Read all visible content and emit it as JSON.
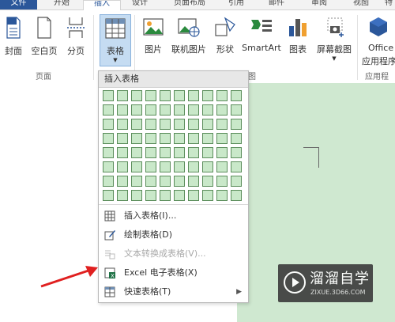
{
  "tabs": [
    {
      "label": "文件"
    },
    {
      "label": "开始"
    },
    {
      "label": "插入"
    },
    {
      "label": "设计"
    },
    {
      "label": "页面布局"
    },
    {
      "label": "引用"
    },
    {
      "label": "邮件"
    },
    {
      "label": "审阅"
    },
    {
      "label": "视图"
    },
    {
      "label": "特"
    }
  ],
  "ribbon": {
    "pages_group": {
      "label": "页面",
      "buttons": [
        {
          "label": "封面",
          "icon": "cover-page-icon"
        },
        {
          "label": "空白页",
          "icon": "blank-page-icon"
        },
        {
          "label": "分页",
          "icon": "page-break-icon"
        }
      ]
    },
    "table_button": {
      "label": "表格",
      "icon": "table-icon"
    },
    "illustrations_group": {
      "label": "图",
      "buttons": [
        {
          "label": "图片",
          "icon": "picture-icon"
        },
        {
          "label": "联机图片",
          "icon": "online-picture-icon"
        },
        {
          "label": "形状",
          "icon": "shapes-icon"
        },
        {
          "label": "SmartArt",
          "icon": "smartart-icon"
        },
        {
          "label": "图表",
          "icon": "chart-icon"
        },
        {
          "label": "屏幕截图",
          "icon": "screenshot-icon"
        }
      ]
    },
    "apps_group": {
      "label": "应用程序",
      "button": {
        "label": "Office",
        "label2": "应用程序",
        "icon": "office-apps-icon"
      }
    }
  },
  "dropdown": {
    "header": "插入表格",
    "grid": {
      "cols": 10,
      "rows": 8
    },
    "items": [
      {
        "label": "插入表格(I)...",
        "icon": "insert-table-icon",
        "disabled": false
      },
      {
        "label": "绘制表格(D)",
        "icon": "draw-table-icon",
        "disabled": false
      },
      {
        "label": "文本转换成表格(V)...",
        "icon": "text-to-table-icon",
        "disabled": true
      },
      {
        "label": "Excel 电子表格(X)",
        "icon": "excel-sheet-icon",
        "disabled": false
      },
      {
        "label": "快速表格(T)",
        "icon": "quick-tables-icon",
        "disabled": false,
        "submenu": "▶"
      }
    ]
  },
  "watermark": {
    "title": "溜溜自学",
    "subtitle": "ZIXUE.3D66.COM"
  },
  "colors": {
    "accent": "#2b579a",
    "page_bg": "#cfe8d0",
    "grid_cell": "#c9e8c9",
    "arrow": "#e02020"
  }
}
